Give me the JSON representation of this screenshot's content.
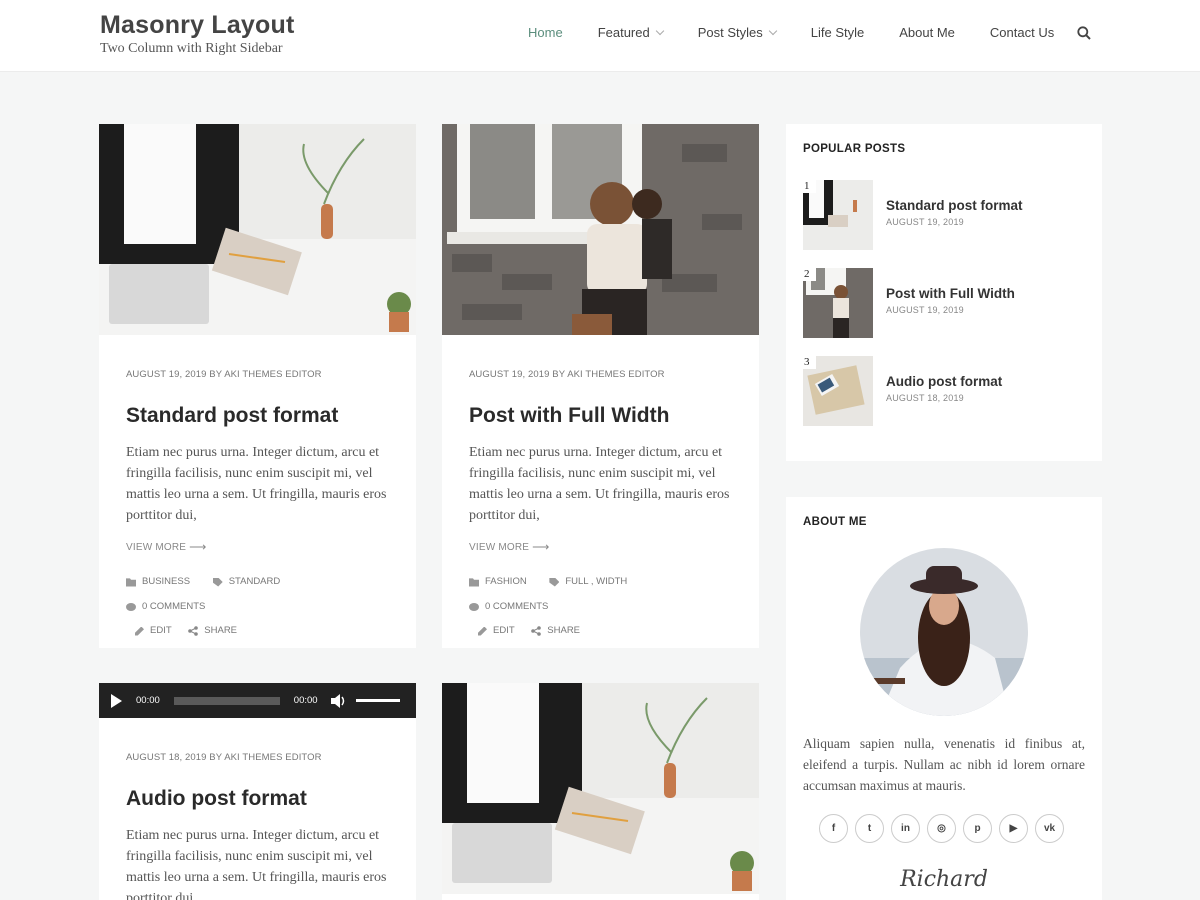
{
  "site": {
    "title": "Masonry Layout",
    "description": "Two Column with Right Sidebar"
  },
  "nav": {
    "items": [
      {
        "label": "Home",
        "active": true,
        "dropdown": false
      },
      {
        "label": "Featured",
        "active": false,
        "dropdown": true
      },
      {
        "label": "Post Styles",
        "active": false,
        "dropdown": true
      },
      {
        "label": "Life Style",
        "active": false,
        "dropdown": false
      },
      {
        "label": "About Me",
        "active": false,
        "dropdown": false
      },
      {
        "label": "Contact Us",
        "active": false,
        "dropdown": false
      }
    ],
    "search_icon": "search-icon"
  },
  "posts": [
    {
      "meta": "AUGUST 19, 2019 BY AKI THEMES EDITOR",
      "title": "Standard post format",
      "excerpt": "Etiam nec purus urna. Integer dictum, arcu et fringilla facilisis, nunc enim suscipit mi, vel mattis leo urna a sem. Ut fringilla, mauris eros porttitor dui,",
      "read_more": "VIEW MORE",
      "category": "BUSINESS",
      "tags": "STANDARD",
      "comments": "0 COMMENTS",
      "edit": "EDIT",
      "share": "SHARE"
    },
    {
      "meta": "AUGUST 19, 2019 BY AKI THEMES EDITOR",
      "title": "Post with Full Width",
      "excerpt": "Etiam nec purus urna. Integer dictum, arcu et fringilla facilisis, nunc enim suscipit mi, vel mattis leo urna a sem. Ut fringilla, mauris eros porttitor dui,",
      "read_more": "VIEW MORE",
      "category": "FASHION",
      "tags": "FULL , WIDTH",
      "comments": "0 COMMENTS",
      "edit": "EDIT",
      "share": "SHARE"
    },
    {
      "meta": "AUGUST 18, 2019 BY AKI THEMES EDITOR",
      "title": "Audio post format",
      "excerpt": "Etiam nec purus urna. Integer dictum, arcu et fringilla facilisis, nunc enim suscipit mi, vel mattis leo urna a sem. Ut fringilla, mauris eros porttitor dui,",
      "audio": {
        "current": "00:00",
        "duration": "00:00"
      }
    }
  ],
  "sidebar": {
    "popular": {
      "title": "POPULAR POSTS",
      "items": [
        {
          "num": "1",
          "title": "Standard post format",
          "date": "AUGUST 19, 2019"
        },
        {
          "num": "2",
          "title": "Post with Full Width",
          "date": "AUGUST 19, 2019"
        },
        {
          "num": "3",
          "title": "Audio post format",
          "date": "AUGUST 18, 2019"
        }
      ]
    },
    "about": {
      "title": "ABOUT ME",
      "text": "Aliquam sapien nulla, venenatis id finibus at, eleifend a turpis. Nullam ac nibh id lorem ornare accumsan maximus at mauris.",
      "socials": [
        {
          "icon": "facebook-icon",
          "glyph": "f"
        },
        {
          "icon": "twitter-icon",
          "glyph": "t"
        },
        {
          "icon": "linkedin-icon",
          "glyph": "in"
        },
        {
          "icon": "instagram-icon",
          "glyph": "◎"
        },
        {
          "icon": "pinterest-icon",
          "glyph": "p"
        },
        {
          "icon": "youtube-icon",
          "glyph": "▶"
        },
        {
          "icon": "vk-icon",
          "glyph": "vk"
        }
      ],
      "signature": "Richard"
    }
  },
  "colors": {
    "accent": "#5b8e7d",
    "background": "#f5f6f6"
  }
}
